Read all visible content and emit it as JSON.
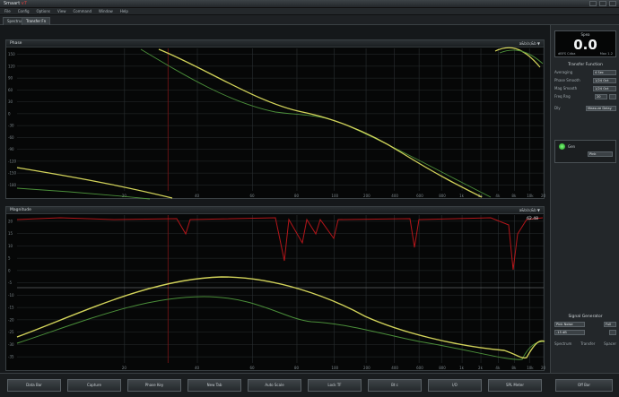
{
  "app": {
    "title_prefix": "Smaart",
    "title_accent": "v7"
  },
  "menu": [
    "File",
    "Config",
    "Options",
    "View",
    "Command",
    "Window",
    "Help"
  ],
  "tabs": [
    {
      "label": "Spectrum",
      "active": false
    },
    {
      "label": "Transfer Fn",
      "active": true
    }
  ],
  "phase_plot": {
    "title": "Phase",
    "right_label": "a&b/a;&b ▼",
    "y_ticks": [
      "150",
      "120",
      "90",
      "60",
      "30",
      "0",
      "-30",
      "-60",
      "-90",
      "-120",
      "-150",
      "-180"
    ],
    "x_ticks": [
      "20",
      "40",
      "60",
      "80",
      "100",
      "200",
      "400",
      "600",
      "800",
      "1k",
      "2k",
      "4k",
      "8k",
      "10k",
      "20k"
    ]
  },
  "magnitude_plot": {
    "title": "Magnitude",
    "right_label": "a&b/a;&b ▼",
    "readout": "62.48",
    "y_ticks": [
      "20",
      "15",
      "10",
      "5",
      "0",
      "-5",
      "-10",
      "-15",
      "-20",
      "-25",
      "-30",
      "-35"
    ],
    "x_ticks": [
      "20",
      "40",
      "60",
      "80",
      "100",
      "200",
      "400",
      "600",
      "800",
      "1k",
      "2k",
      "4k",
      "8k",
      "10k",
      "20k"
    ]
  },
  "sidebar": {
    "level": {
      "label": "Spea",
      "value": "0.0",
      "foot_left": "dBFS Cdba",
      "foot_right": "Max 1.2"
    },
    "transfer_function": {
      "title": "Transfer Function",
      "rows": [
        {
          "label": "Averaging",
          "value": "4 Sec"
        },
        {
          "label": "Phase Smooth",
          "value": "1/24 Oct"
        },
        {
          "label": "Mag Smooth",
          "value": "1/24 Oct"
        },
        {
          "label": "Freq Rng",
          "value": "20"
        }
      ],
      "delay_label": "Dly",
      "delay_value": "Measure Delay"
    },
    "generator_panel": {
      "label": "Gen",
      "value": "Pink"
    },
    "signal_generator": {
      "title": "Signal Generator",
      "rows": [
        {
          "label": "Pink Noise",
          "value": "Full"
        },
        {
          "label": "-15 dB",
          "value": ""
        }
      ],
      "sub_labels": [
        "Spectrum",
        "Transfer",
        "Spacer"
      ]
    }
  },
  "bottom_buttons": [
    "Data Bar",
    "Capture",
    "Phase Key",
    "New Tab",
    "Auto Scale",
    "Lock TF",
    "Bt c",
    "I/O",
    "SPL Meter",
    "Off Bar"
  ],
  "colors": {
    "phase_yellow": "#d2d35a",
    "phase_green": "#4b8f3a",
    "magnitude_red": "#b3161a",
    "grid": "#2a2f31",
    "marker_red": "#7a1416"
  }
}
